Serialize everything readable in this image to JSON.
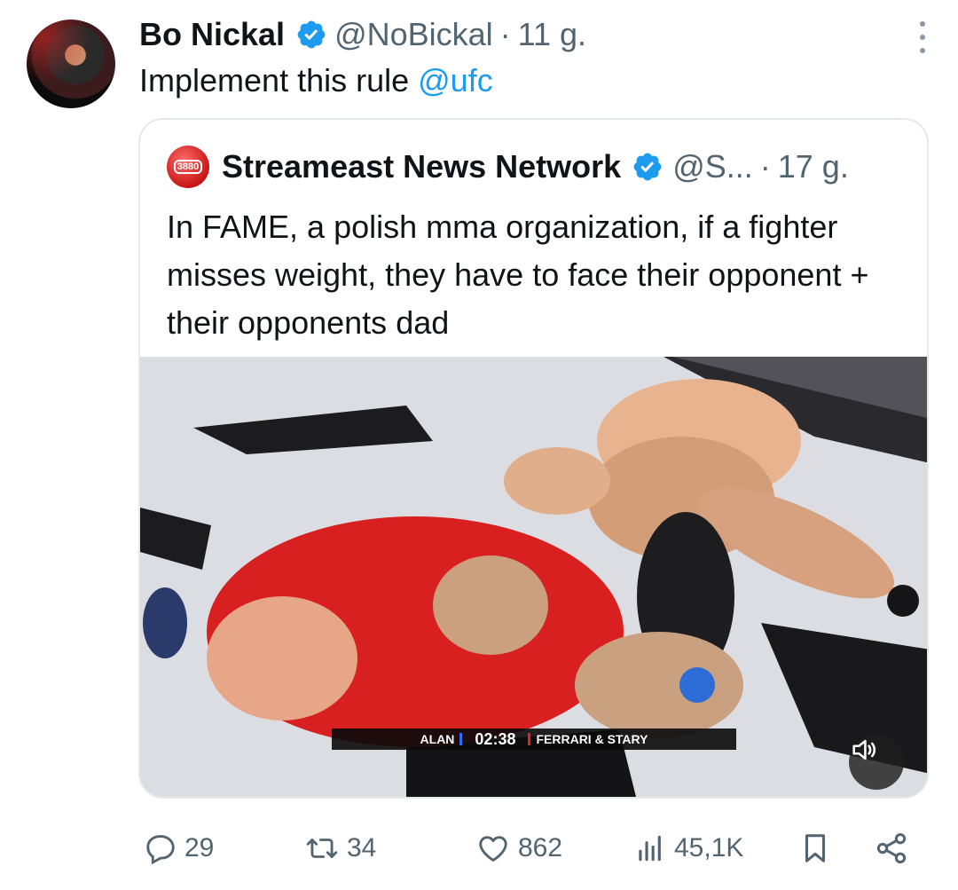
{
  "tweet": {
    "author_name": "Bo Nickal",
    "handle": "@NoBickal",
    "separator": "·",
    "time": "11 g.",
    "text": "Implement this rule ",
    "mention": "@ufc"
  },
  "quote": {
    "avatar_badge": "3880",
    "author_name": "Streameast News Network",
    "handle": "@S...",
    "separator": "·",
    "time": "17 g.",
    "text": "In FAME, a polish mma organization, if a fighter misses weight, they have to face their opponent + their opponents dad",
    "scoreboard": {
      "left": "ALAN",
      "clock": "02:38",
      "right": "FERRARI & STARY"
    }
  },
  "actions": {
    "replies": "29",
    "reposts": "34",
    "likes": "862",
    "views": "45,1K"
  },
  "colors": {
    "accent": "#1d9bf0",
    "muted": "#536471"
  },
  "icons": [
    "verified-badge-icon",
    "more-icon",
    "volume-icon",
    "reply-icon",
    "repost-icon",
    "like-icon",
    "views-icon",
    "bookmark-icon",
    "share-icon"
  ]
}
